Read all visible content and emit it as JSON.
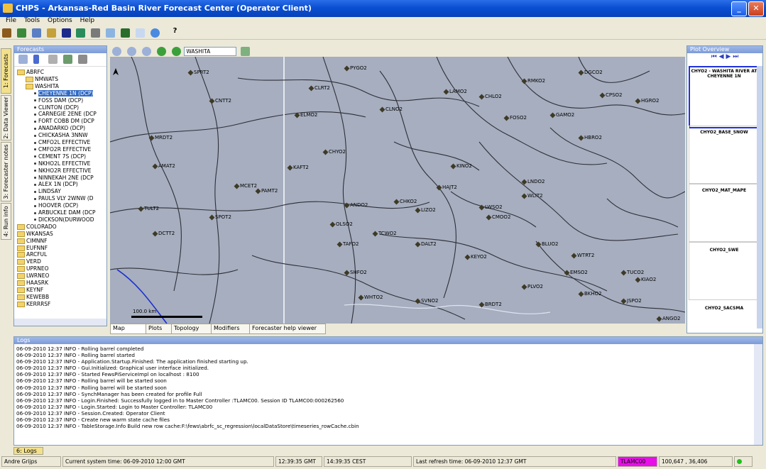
{
  "window": {
    "title": "CHPS - Arkansas-Red Basin River Forecast Center  (Operator Client)"
  },
  "menu": [
    "File",
    "Tools",
    "Options",
    "Help"
  ],
  "side_tabs": [
    "1: Forecasts",
    "2: Data Viewer",
    "3: Forecaster notes",
    "4: Run info"
  ],
  "forecasts": {
    "title": "Forecasts",
    "tree": [
      {
        "label": "ABRFC",
        "level": 0,
        "type": "folder"
      },
      {
        "label": "NMWATS",
        "level": 1,
        "type": "folder"
      },
      {
        "label": "WASHITA",
        "level": 1,
        "type": "folder"
      },
      {
        "label": "CHEYENNE 1N (DCP)",
        "level": 2,
        "type": "leaf",
        "selected": true
      },
      {
        "label": "FOSS DAM (DCP)",
        "level": 2,
        "type": "leaf"
      },
      {
        "label": "CLINTON (DCP)",
        "level": 2,
        "type": "leaf"
      },
      {
        "label": "CARNEGIE 2ENE (DCP",
        "level": 2,
        "type": "leaf"
      },
      {
        "label": "FORT COBB DM (DCP",
        "level": 2,
        "type": "leaf"
      },
      {
        "label": "ANADARKO (DCP)",
        "level": 2,
        "type": "leaf"
      },
      {
        "label": "CHICKASHA 3NNW",
        "level": 2,
        "type": "leaf"
      },
      {
        "label": "CMFO2L EFFECTIVE",
        "level": 2,
        "type": "leaf"
      },
      {
        "label": "CMFO2R EFFECTIVE",
        "level": 2,
        "type": "leaf"
      },
      {
        "label": "CEMENT 7S   (DCP)",
        "level": 2,
        "type": "leaf"
      },
      {
        "label": "NKHO2L EFFECTIVE",
        "level": 2,
        "type": "leaf"
      },
      {
        "label": "NKHO2R EFFECTIVE",
        "level": 2,
        "type": "leaf"
      },
      {
        "label": "NINNEKAH 2NE (DCP",
        "level": 2,
        "type": "leaf"
      },
      {
        "label": "ALEX 1N (DCP)",
        "level": 2,
        "type": "leaf"
      },
      {
        "label": "LINDSAY",
        "level": 2,
        "type": "leaf"
      },
      {
        "label": "PAULS VLY 2WNW (D",
        "level": 2,
        "type": "leaf"
      },
      {
        "label": "HOOVER (DCP)",
        "level": 2,
        "type": "leaf"
      },
      {
        "label": "ARBUCKLE DAM (DCP",
        "level": 2,
        "type": "leaf"
      },
      {
        "label": "DICKSON(DURWOOD",
        "level": 2,
        "type": "leaf"
      },
      {
        "label": "COLORADO",
        "level": 0,
        "type": "folder"
      },
      {
        "label": "WKANSAS",
        "level": 0,
        "type": "folder"
      },
      {
        "label": "CIMNNF",
        "level": 0,
        "type": "folder"
      },
      {
        "label": "EUFNNF",
        "level": 0,
        "type": "folder"
      },
      {
        "label": "ARCFUL",
        "level": 0,
        "type": "folder"
      },
      {
        "label": "VERD",
        "level": 0,
        "type": "folder"
      },
      {
        "label": "UPRNEO",
        "level": 0,
        "type": "folder"
      },
      {
        "label": "LWRNEO",
        "level": 0,
        "type": "folder"
      },
      {
        "label": "HAASRK",
        "level": 0,
        "type": "folder"
      },
      {
        "label": "KEYNF",
        "level": 0,
        "type": "folder"
      },
      {
        "label": "KEWEBB",
        "level": 0,
        "type": "folder"
      },
      {
        "label": "KERRRSF",
        "level": 0,
        "type": "folder"
      }
    ]
  },
  "map": {
    "basin_select": "WASHITA",
    "scale_label": "100.0 km",
    "stations": [
      "SPRT2",
      "DGCO2",
      "PYGO2",
      "CLRT2",
      "RMKO2",
      "CHLO2",
      "LAMO2",
      "HGRO2",
      "CPSO2",
      "CNTT2",
      "AMAT2",
      "MRDT2",
      "CHYO2",
      "KINO2",
      "ELMO2",
      "FOSO2",
      "CLNO2",
      "GAMO2",
      "HBRO2",
      "MCET2",
      "PAMT2",
      "KAFT2",
      "TULT2",
      "SPOT2",
      "ANDO2",
      "CHKO2",
      "LIZO2",
      "LWSO2",
      "LNDO2",
      "WLIT2",
      "CMOO2",
      "HAJT2",
      "OLSO2",
      "DCTT2",
      "TAFO2",
      "TCWO2",
      "DALT2",
      "KEYO2",
      "BLUO2",
      "WTRT2",
      "EMSO2",
      "TUCO2",
      "SHFO2",
      "WHTO2",
      "SVNO2",
      "BRDT2",
      "PLVO2",
      "BKHO2",
      "KIAO2",
      "JSPO2",
      "ANGO2"
    ],
    "tabs": [
      "Map",
      "Plots",
      "Topology",
      "Modifiers",
      "Forecaster help viewer"
    ]
  },
  "overview": {
    "title": "Plot Overview",
    "items": [
      "CHYO2 - WASHITA RIVER AT CHEYENNE 1N",
      "CHYO2_BASE_SNOW",
      "CHYO2_MAT_MAPE",
      "CHYO2_SWE",
      "CHYO2_SACSMA"
    ]
  },
  "log": {
    "title": "Logs",
    "lines": [
      "06-09-2010 12:37 INFO - Rolling barrel completed",
      "06-09-2010 12:37 INFO - Rolling barrel started",
      "06-09-2010 12:37 INFO - Application.Startup.Finished: The application finished starting up.",
      "06-09-2010 12:37 INFO - Gui.Initialized: Graphical user interface initialized.",
      "06-09-2010 12:37 INFO - Started FewsPiServiceImpl on localhost : 8100",
      "06-09-2010 12:37 INFO - Rolling barrel will be started soon",
      "06-09-2010 12:37 INFO - Rolling barrel will be started soon",
      "06-09-2010 12:37 INFO - SynchManager has been created for profile Full",
      "06-09-2010 12:37 INFO - Login.Finished: Successfully logged in to Master Controller :TLAMC00. Session ID TLAMC00:000262560",
      "06-09-2010 12:37 INFO - Login.Started: Login to Master Controller: TLAMC00",
      "06-09-2010 12:37 INFO - Session.Created: Operator Client",
      "06-09-2010 12:37 INFO - Create new warm state cache files",
      "06-09-2010 12:37 INFO - TableStorage.Info Build new row cache:F:\\fews\\abrfc_sc_regression\\localDataStore\\timeseries_rowCache.cbin"
    ],
    "tab": "6: Logs"
  },
  "status": {
    "user": "Andre Grijps",
    "system_time": "Current system time: 06-09-2010 12:00 GMT",
    "gmt": "12:39:35 GMT",
    "cest": "14:39:35 CEST",
    "last_refresh": "Last refresh time: 06-09-2010 12:37 GMT",
    "controller": "TLAMC00",
    "coords": "100,647 , 36,406"
  }
}
